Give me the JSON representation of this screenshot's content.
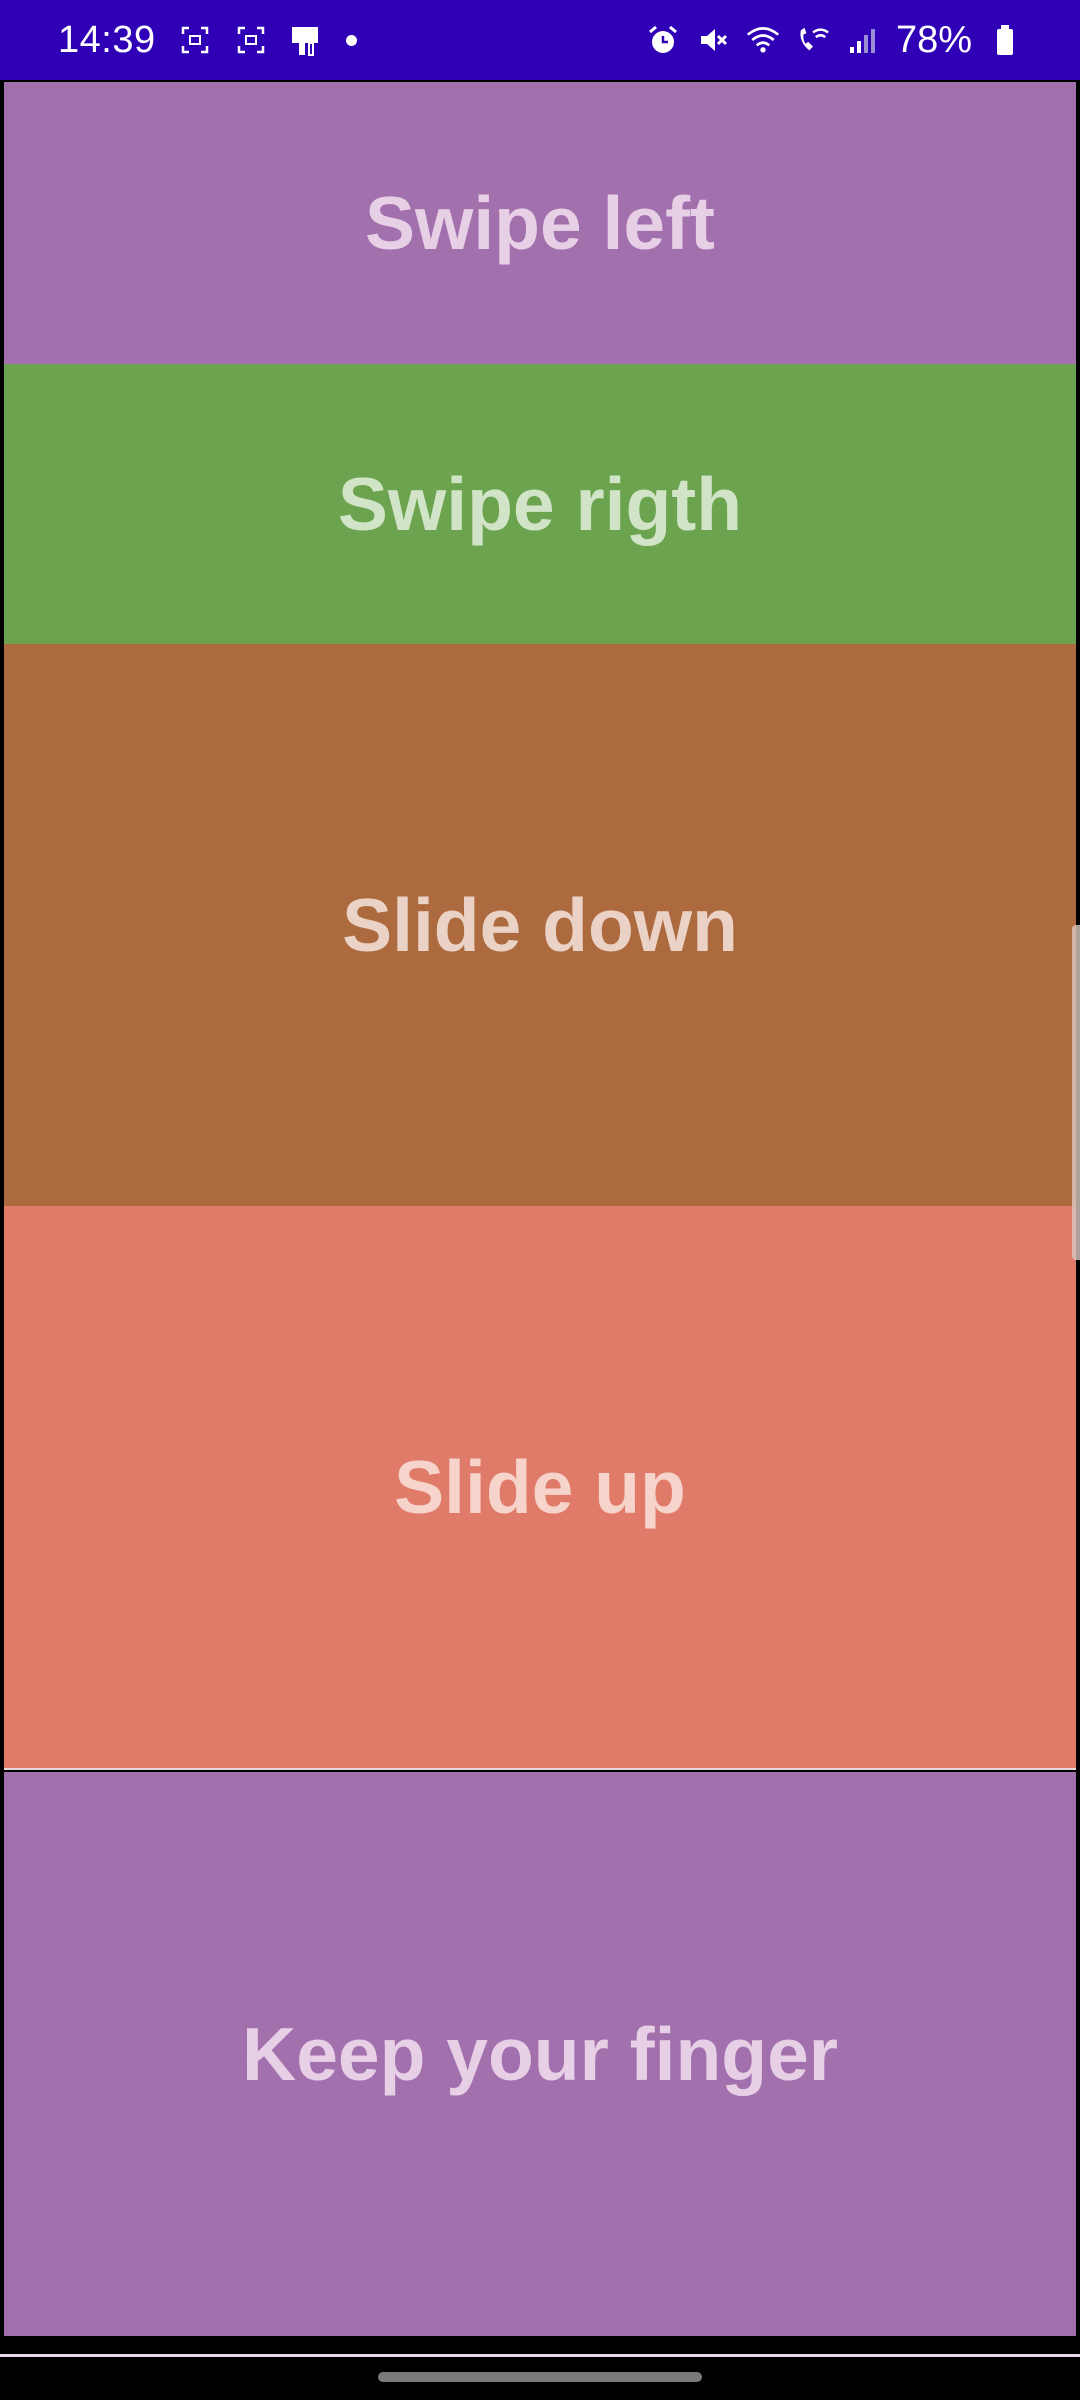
{
  "status_bar": {
    "time": "14:39",
    "battery": "78%",
    "background": "#3000b7",
    "left_icons": [
      "screenshot-icon",
      "screenshot-icon",
      "sim-card-icon",
      "notification-dot-icon"
    ],
    "right_icons": [
      "alarm-icon",
      "mute-icon",
      "wifi-icon",
      "wifi-calling-icon",
      "signal-icon",
      "battery-icon"
    ]
  },
  "panels": [
    {
      "label": "Swipe left",
      "background": "#a270ad",
      "text_color": "#e7d0e6"
    },
    {
      "label": "Swipe rigth",
      "background": "#6ba34e",
      "text_color": "#d2e4c8"
    },
    {
      "label": "Slide down",
      "background": "#ad6a3e",
      "text_color": "#ead2c6"
    },
    {
      "label": "Slide up",
      "background": "#df7b68",
      "text_color": "#f6d3cb"
    },
    {
      "label": "Keep your finger",
      "background": "#a270ad",
      "text_color": "#e7d0e6"
    }
  ]
}
